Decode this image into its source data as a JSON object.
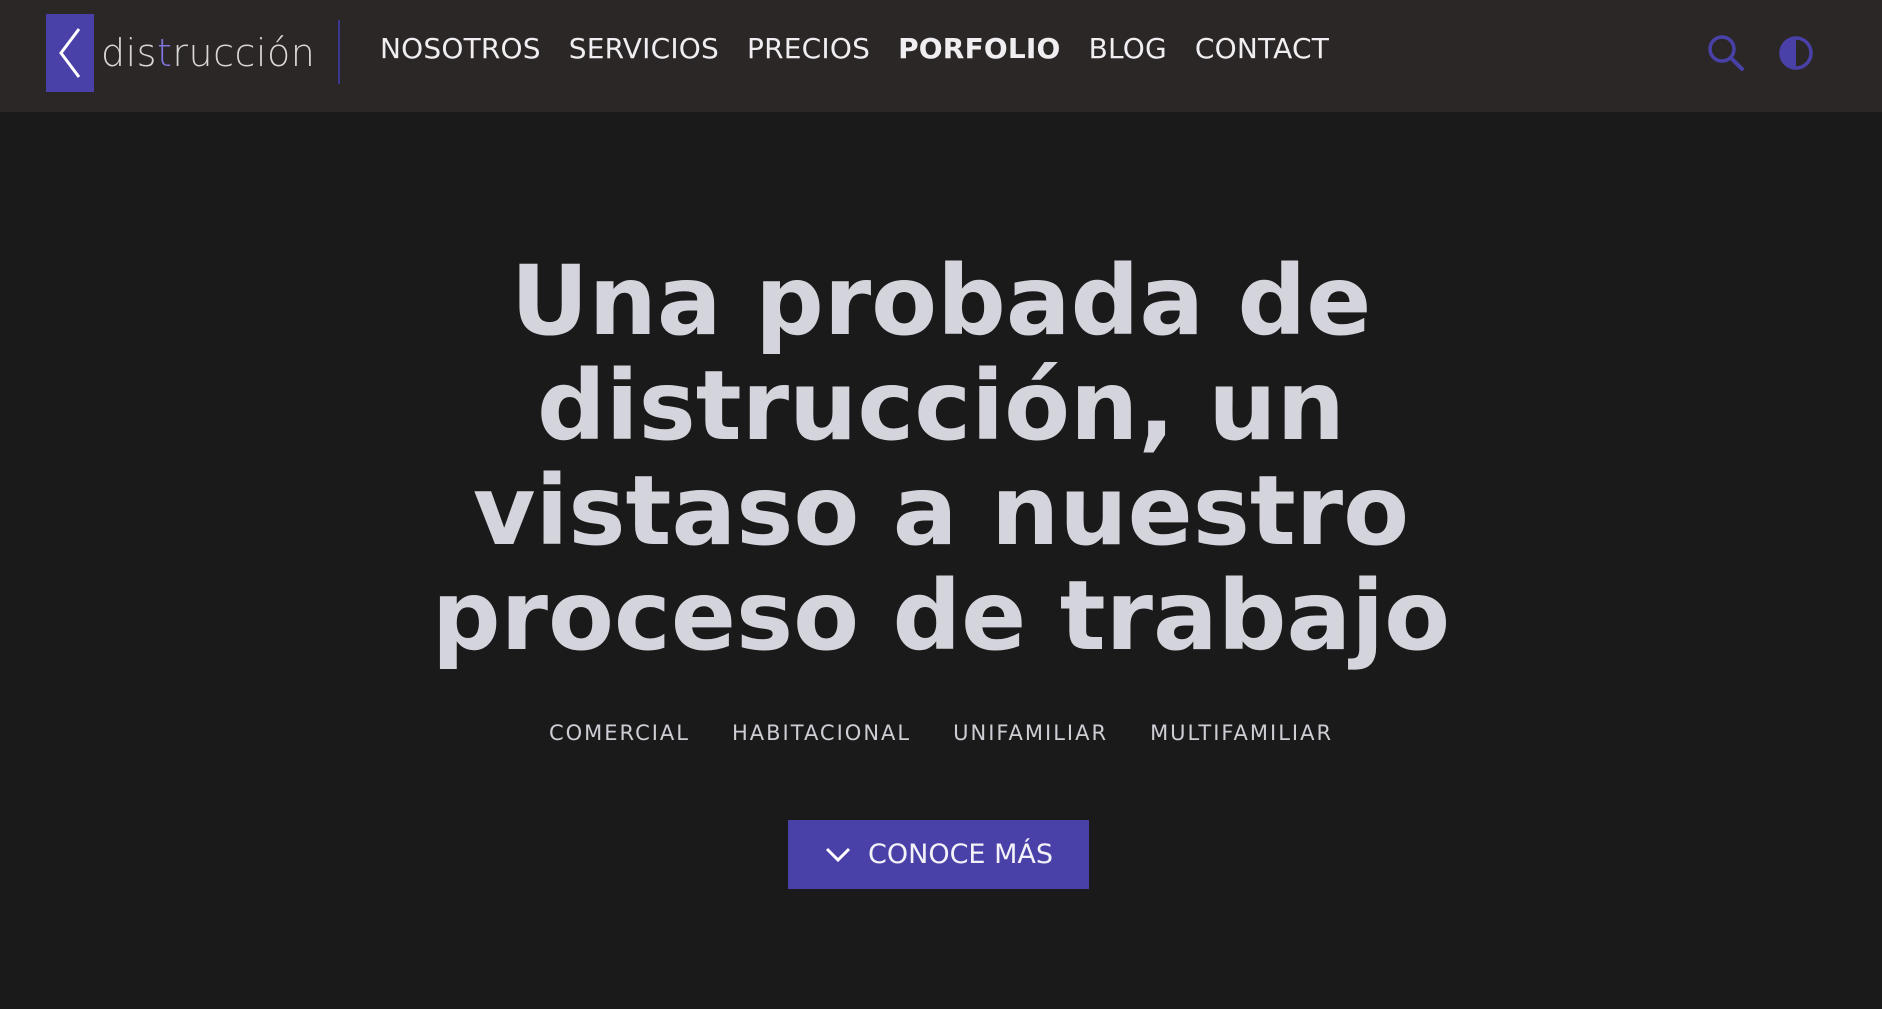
{
  "brand": {
    "name_prefix": "dis",
    "name_accent": "t",
    "name_suffix": "rucción"
  },
  "nav": {
    "items": [
      {
        "label": "NOSOTROS"
      },
      {
        "label": "SERVICIOS"
      },
      {
        "label": "PRECIOS"
      },
      {
        "label": "PORFOLIO",
        "active": true
      },
      {
        "label": "BLOG"
      },
      {
        "label": "CONTACT"
      }
    ]
  },
  "icons": {
    "logo": "chevron-left-icon",
    "search": "search-icon",
    "theme": "contrast-icon",
    "cta": "chevron-down-icon"
  },
  "hero": {
    "title": "Una probada de distrucción, un vistaso a nuestro proceso de trabajo",
    "tags": [
      "COMERCIAL",
      "HABITACIONAL",
      "UNIFAMILIAR",
      "MULTIFAMILIAR"
    ],
    "cta_label": "CONOCE MÁS"
  },
  "colors": {
    "background": "#1b1a1b",
    "header": "#2a2726",
    "accent": "#4a41a8",
    "accent_light": "#7d74e0",
    "title": "#d4d4dc"
  }
}
